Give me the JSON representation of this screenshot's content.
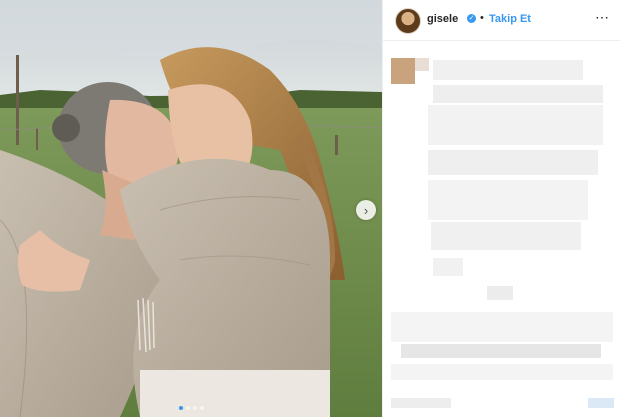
{
  "header": {
    "username": "gisele",
    "separator": "•",
    "follow_label": "Takip Et",
    "more_icon": "⋯",
    "verified_icon": "✓"
  },
  "photo": {
    "next_icon": "›",
    "carousel_total": 4,
    "carousel_active": 0
  },
  "colors": {
    "accent": "#3897f0",
    "text": "#262626",
    "border": "#efefef"
  }
}
